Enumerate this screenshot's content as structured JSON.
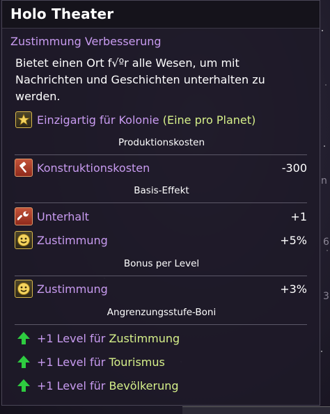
{
  "tooltip": {
    "title": "Holo Theater",
    "subtitle": "Zustimmung Verbesserung",
    "description": "Bietet einen Ort f√ºr alle Wesen, um mit Nachrichten und Geschichten unterhalten zu werden.",
    "unique": {
      "label": "Einzigartig für Kolonie",
      "detail": "(Eine pro Planet)",
      "icon": "star-icon"
    },
    "sections": {
      "production": "Produktionskosten",
      "base": "Basis-Effekt",
      "per_level": "Bonus per Level",
      "adjacency": "Angrenzungsstufe-Boni"
    },
    "production_rows": [
      {
        "label": "Konstruktionskosten",
        "value": "-300",
        "icon": "hammer-icon"
      }
    ],
    "base_rows": [
      {
        "label": "Unterhalt",
        "value": "+1",
        "icon": "wrench-icon"
      },
      {
        "label": "Zustimmung",
        "value": "+5%",
        "icon": "smiley-icon"
      }
    ],
    "level_rows": [
      {
        "label": "Zustimmung",
        "value": "+3%",
        "icon": "smiley-icon"
      }
    ],
    "adjacency_rows": [
      {
        "prefix": "+1 Level für",
        "target": "Zustimmung",
        "icon": "arrow-up-icon"
      },
      {
        "prefix": "+1 Level für",
        "target": "Tourismus",
        "icon": "arrow-up-icon"
      },
      {
        "prefix": "+1 Level für",
        "target": "Bevölkerung",
        "icon": "arrow-up-icon"
      }
    ]
  },
  "background": {
    "edge_chars": [
      "n",
      "6",
      "3"
    ]
  },
  "colors": {
    "accent_purple": "#c89bf0",
    "highlight_green": "#d6f08a",
    "arrow_green": "#2ecc40",
    "icon_gold": "#d9b84a"
  }
}
